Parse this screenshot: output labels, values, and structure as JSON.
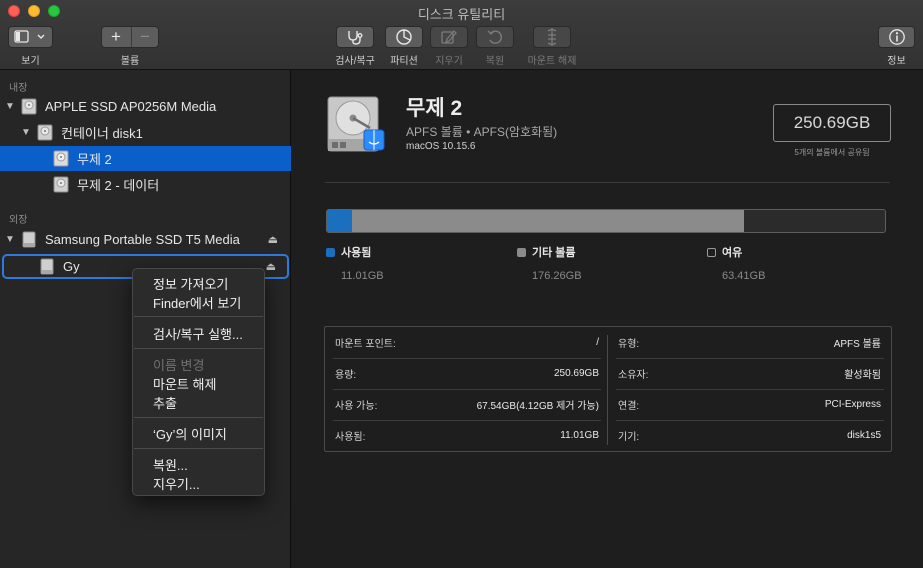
{
  "window": {
    "title": "디스크 유틸리티"
  },
  "toolbar": {
    "view_label": "보기",
    "volume_label": "볼륨",
    "firstaid_label": "검사/복구",
    "partition_label": "파티션",
    "erase_label": "지우기",
    "restore_label": "복원",
    "unmount_label": "마운트 해제",
    "info_label": "정보",
    "add_glyph": "+",
    "remove_glyph": "−"
  },
  "sidebar": {
    "internal_header": "내장",
    "external_header": "외장",
    "items": [
      {
        "label": "APPLE SSD AP0256M Media",
        "level": 0,
        "expanded": true
      },
      {
        "label": "컨테이너 disk1",
        "level": 1,
        "expanded": true
      },
      {
        "label": "무제 2",
        "level": 2,
        "selected": true
      },
      {
        "label": "무제 2 - 데이터",
        "level": 2
      },
      {
        "label": "Samsung Portable SSD T5 Media",
        "level": 0,
        "expanded": true,
        "eject": true
      },
      {
        "label": "Gy",
        "level": 1,
        "eject": true,
        "outlined": true
      }
    ],
    "eject_glyph": "⏏"
  },
  "context_menu": {
    "items": [
      {
        "label": "정보 가져오기",
        "enabled": true
      },
      {
        "label": "Finder에서 보기",
        "enabled": true
      },
      {
        "label": "검사/복구 실행...",
        "enabled": true
      },
      {
        "label": "이름 변경",
        "enabled": false
      },
      {
        "label": "마운트 해제",
        "enabled": true
      },
      {
        "label": "추출",
        "enabled": true
      },
      {
        "label": "‘Gy’의 이미지",
        "enabled": true
      },
      {
        "label": "복원...",
        "enabled": true
      },
      {
        "label": "지우기...",
        "enabled": true
      }
    ]
  },
  "volume": {
    "name": "무제 2",
    "type": "APFS 볼륨 • APFS(암호화됨)",
    "os": "macOS 10.15.6",
    "capacity": "250.69GB",
    "shared_note": "5개의 볼륨에서 공유됨"
  },
  "usage": {
    "used_fraction": 0.044,
    "other_fraction": 0.703,
    "legend": [
      {
        "name": "사용됨",
        "value": "11.01GB",
        "color": "#1a6fbf",
        "shape": "square"
      },
      {
        "name": "기타 볼륨",
        "value": "176.26GB",
        "color": "#8b8b8b",
        "shape": "square"
      },
      {
        "name": "여유",
        "value": "63.41GB",
        "color": "#2b2b2b",
        "shape": "square-outline"
      }
    ]
  },
  "info": {
    "left": [
      {
        "key": "마운트 포인트:",
        "value": "/"
      },
      {
        "key": "용량:",
        "value": "250.69GB"
      },
      {
        "key": "사용 가능:",
        "value": "67.54GB(4.12GB 제거 가능)"
      },
      {
        "key": "사용됨:",
        "value": "11.01GB"
      }
    ],
    "right": [
      {
        "key": "유형:",
        "value": "APFS 볼륨"
      },
      {
        "key": "소유자:",
        "value": "활성화됨"
      },
      {
        "key": "연결:",
        "value": "PCI-Express"
      },
      {
        "key": "기기:",
        "value": "disk1s5"
      }
    ]
  }
}
